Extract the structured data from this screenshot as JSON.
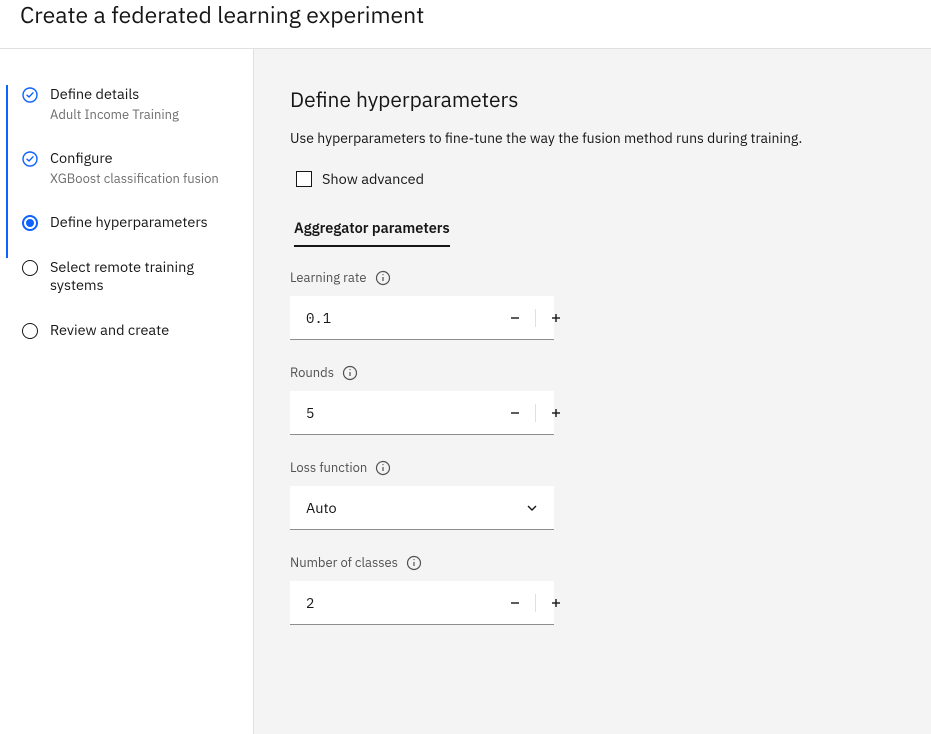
{
  "header": {
    "title": "Create a federated learning experiment"
  },
  "sidebar": {
    "steps": [
      {
        "label": "Define details",
        "sub": "Adult Income Training"
      },
      {
        "label": "Configure",
        "sub": "XGBoost classification fusion"
      },
      {
        "label": "Define hyperparameters",
        "sub": ""
      },
      {
        "label": "Select remote training systems",
        "sub": ""
      },
      {
        "label": "Review and create",
        "sub": ""
      }
    ]
  },
  "main": {
    "heading": "Define hyperparameters",
    "description": "Use hyperparameters to fine-tune the way the fusion method runs during training.",
    "show_advanced_label": "Show advanced",
    "section_tab": "Aggregator parameters",
    "fields": {
      "learning_rate": {
        "label": "Learning rate",
        "value": "0.1"
      },
      "rounds": {
        "label": "Rounds",
        "value": "5"
      },
      "loss_function": {
        "label": "Loss function",
        "value": "Auto"
      },
      "num_classes": {
        "label": "Number of classes",
        "value": "2"
      }
    }
  }
}
